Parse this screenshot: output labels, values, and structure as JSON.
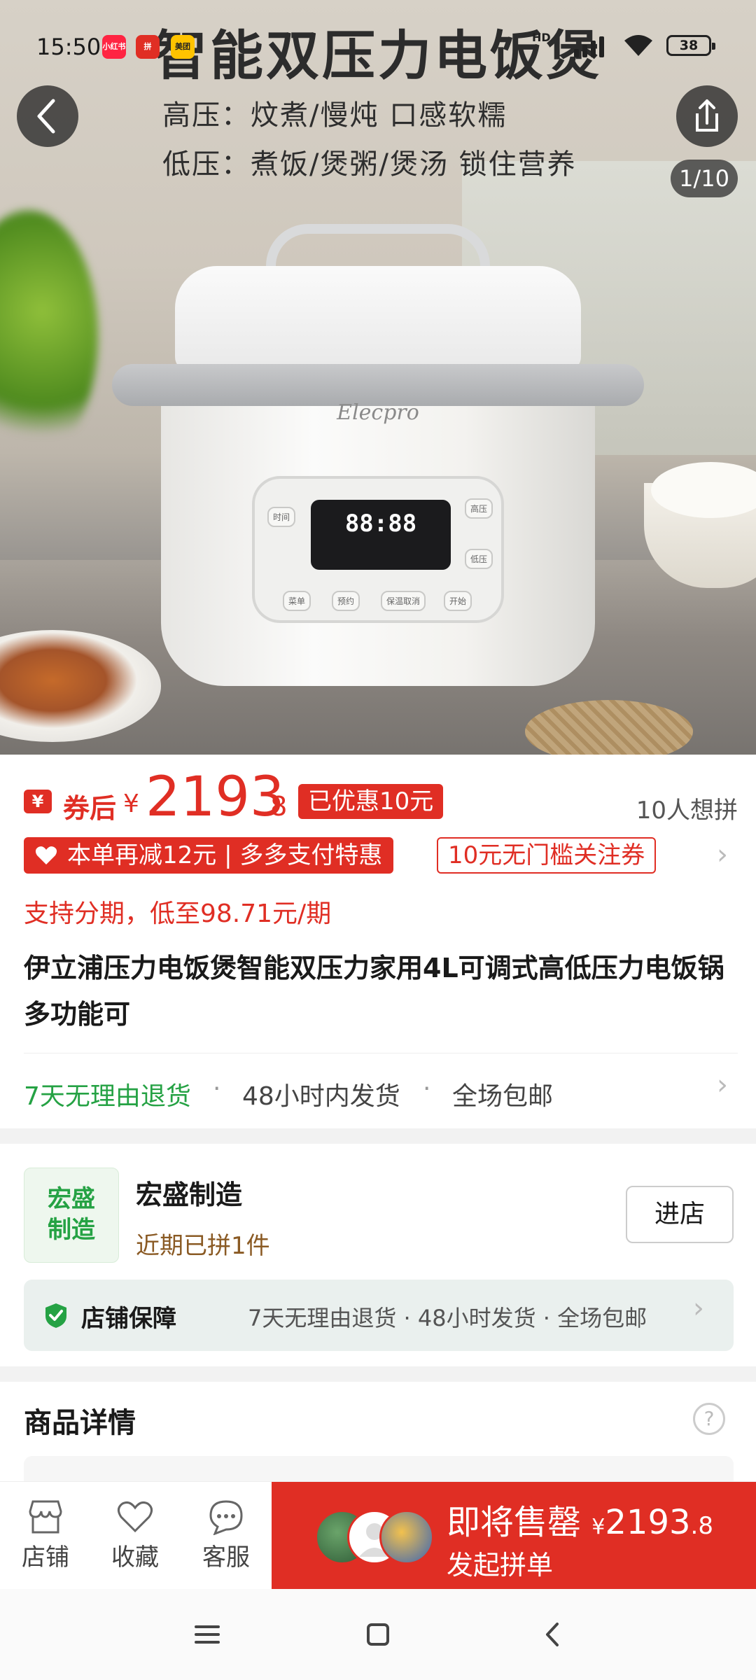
{
  "status_bar": {
    "time": "15:50",
    "apps": [
      {
        "name": "xiaohongshu-icon",
        "label": "小红书",
        "color": "#ff2442"
      },
      {
        "name": "pinduoduo-icon",
        "label": "拼",
        "color": "#e02e24"
      },
      {
        "name": "meituan-icon",
        "label": "美团",
        "color": "#ffc300"
      }
    ],
    "network": "HD",
    "battery": "38"
  },
  "hero": {
    "headline": "智能双压力电饭煲",
    "line1": "高压：炆煮/慢炖  口感软糯",
    "line2": "低压：煮饭/煲粥/煲汤 锁住营养",
    "brand": "Elecpro",
    "display": "88:88",
    "panel_buttons": [
      "时间",
      "高压",
      "低压",
      "菜单",
      "预约",
      "保温取消",
      "开始"
    ],
    "counter": "1/10"
  },
  "price": {
    "coupon_icon": "¥",
    "label": "券后",
    "currency": "¥",
    "integer": "2193",
    "decimal": ".8",
    "discount_badge": "已优惠10元",
    "want_count": "10人想拼"
  },
  "promos": {
    "primary": "本单再减12元 | 多多支付特惠",
    "secondary": "10元无门槛关注券"
  },
  "installment": "支持分期，低至98.71元/期",
  "title": "伊立浦压力电饭煲智能双压力家用4L可调式高低压力电饭锅多功能可",
  "services": {
    "s1": "7天无理由退货",
    "s2": "48小时内发货",
    "s3": "全场包邮",
    "dot": "·"
  },
  "store": {
    "logo_text": "宏盛制造",
    "name": "宏盛制造",
    "sub": "近期已拼1件",
    "enter": "进店"
  },
  "guarantee": {
    "title": "店铺保障",
    "items": "7天无理由退货 · 48小时发货 · 全场包邮"
  },
  "detail": {
    "title": "商品详情",
    "help": "?"
  },
  "bottom_bar": {
    "store": "店铺",
    "favorite": "收藏",
    "service": "客服",
    "buy_line1": "即将售罄",
    "buy_currency": "¥",
    "buy_integer": "2193",
    "buy_decimal": ".8",
    "buy_line2": "发起拼单"
  },
  "colors": {
    "accent": "#e02e24",
    "green": "#25a244"
  }
}
